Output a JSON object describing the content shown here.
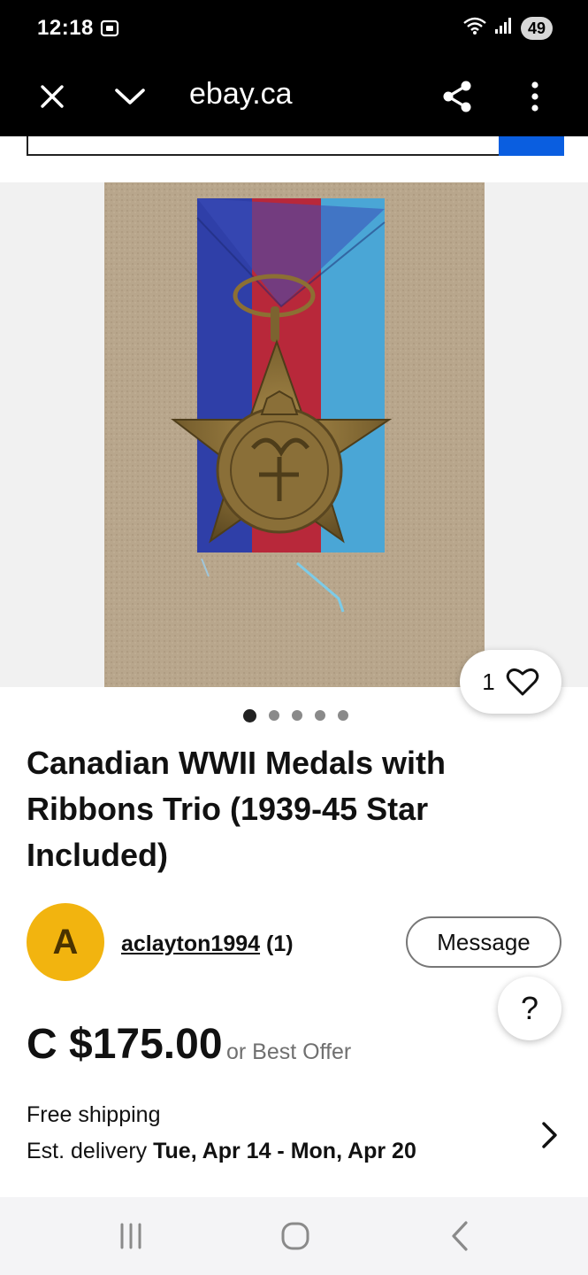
{
  "status_bar": {
    "time": "12:18",
    "battery": "49"
  },
  "browser": {
    "url": "ebay.ca"
  },
  "gallery": {
    "watch_count": "1",
    "dot_count": 5,
    "active_dot": 0
  },
  "listing": {
    "title": "Canadian WWII Medals with Ribbons Trio (1939-45 Star Included)",
    "seller": {
      "avatar_letter": "A",
      "username": "aclayton1994",
      "feedback": "(1)"
    },
    "message_label": "Message",
    "help_label": "?",
    "price": "C $175.00",
    "best_offer": "or Best Offer",
    "shipping": "Free shipping",
    "delivery_prefix": "Est. delivery",
    "delivery_dates": "Tue, Apr 14 - Mon, Apr 20"
  },
  "colors": {
    "accent": "#0a5ee0",
    "avatar": "#f2b40f"
  }
}
